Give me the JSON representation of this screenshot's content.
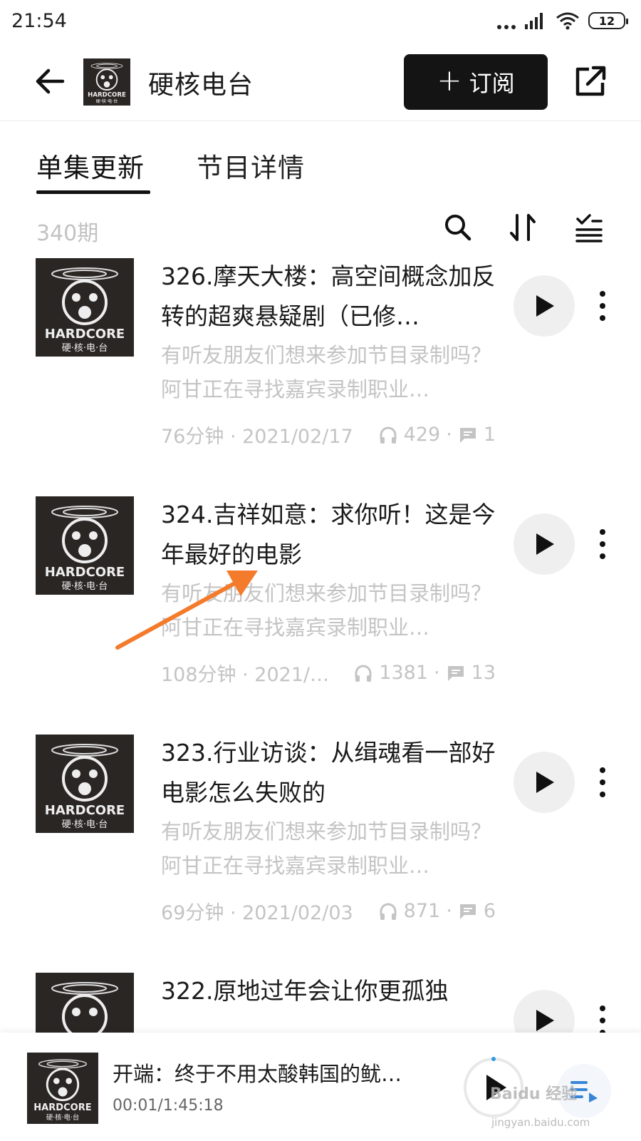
{
  "status_bar": {
    "time": "21:54",
    "battery": "12"
  },
  "header": {
    "title": "硬核电台",
    "subscribe_label": "订阅"
  },
  "tabs": [
    {
      "label": "单集更新",
      "active": true
    },
    {
      "label": "节目详情",
      "active": false
    }
  ],
  "toolbar": {
    "count": "340期"
  },
  "cover_text": {
    "brand": "HARDCORE",
    "sub": "硬·核·电·台"
  },
  "episodes": [
    {
      "title": "326.摩天大楼：高空间概念加反转的超爽悬疑剧（已修…",
      "description": "有听友朋友们想来参加节目录制吗？阿甘正在寻找嘉宾录制职业…",
      "duration_date": "76分钟 · 2021/02/17",
      "plays": "429",
      "comments": "1"
    },
    {
      "title": "324.吉祥如意：求你听！这是今年最好的电影",
      "description": "有听友朋友们想来参加节目录制吗？阿甘正在寻找嘉宾录制职业…",
      "duration_date": "108分钟 · 2021/…",
      "plays": "1381",
      "comments": "13"
    },
    {
      "title": "323.行业访谈：从缉魂看一部好电影怎么失败的",
      "description": "有听友朋友们想来参加节目录制吗？阿甘正在寻找嘉宾录制职业…",
      "duration_date": "69分钟 · 2021/02/03",
      "plays": "871",
      "comments": "6"
    },
    {
      "title": "322.原地过年会让你更孤独"
    }
  ],
  "mini_player": {
    "title": "开端：终于不用太酸韩国的鱿…",
    "time": "00:01/1:45:18"
  },
  "watermark": {
    "text": "Baidu 经验",
    "url": "jingyan.baidu.com"
  },
  "colors": {
    "accent_dark": "#141414",
    "muted_text": "#c4c4c4",
    "annotation": "#f47b2b"
  }
}
